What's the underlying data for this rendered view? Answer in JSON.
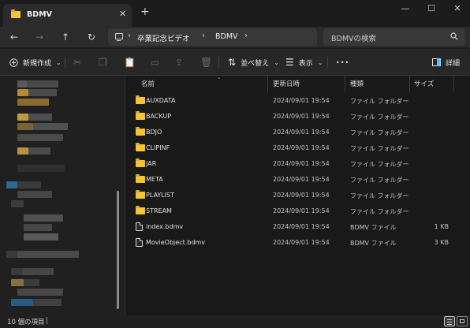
{
  "window": {
    "tab_title": "BDMV",
    "tab_close": "✕",
    "new_tab": "+",
    "minimize": "—",
    "maximize": "☐",
    "close": "✕"
  },
  "address": {
    "back": "←",
    "forward": "→",
    "up": "↑",
    "refresh": "↻",
    "crumbs": [
      "卒業記念ビデオ",
      "BDMV"
    ],
    "separator": "›",
    "search_placeholder": "BDMVの検索"
  },
  "toolbar": {
    "new_label": "新規作成",
    "sort_label": "並べ替え",
    "view_label": "表示",
    "more": "•••",
    "details_label": "詳細"
  },
  "columns": {
    "name": "名前",
    "modified": "更新日時",
    "type": "種類",
    "size": "サイズ"
  },
  "files": [
    {
      "name": "AUXDATA",
      "modified": "2024/09/01 19:54",
      "type": "ファイル フォルダー",
      "size": "",
      "kind": "folder"
    },
    {
      "name": "BACKUP",
      "modified": "2024/09/01 19:54",
      "type": "ファイル フォルダー",
      "size": "",
      "kind": "folder"
    },
    {
      "name": "BDJO",
      "modified": "2024/09/01 19:54",
      "type": "ファイル フォルダー",
      "size": "",
      "kind": "folder"
    },
    {
      "name": "CLIPINF",
      "modified": "2024/09/01 19:54",
      "type": "ファイル フォルダー",
      "size": "",
      "kind": "folder"
    },
    {
      "name": "JAR",
      "modified": "2024/09/01 19:54",
      "type": "ファイル フォルダー",
      "size": "",
      "kind": "folder"
    },
    {
      "name": "META",
      "modified": "2024/09/01 19:54",
      "type": "ファイル フォルダー",
      "size": "",
      "kind": "folder"
    },
    {
      "name": "PLAYLIST",
      "modified": "2024/09/01 19:54",
      "type": "ファイル フォルダー",
      "size": "",
      "kind": "folder"
    },
    {
      "name": "STREAM",
      "modified": "2024/09/01 19:54",
      "type": "ファイル フォルダー",
      "size": "",
      "kind": "folder"
    },
    {
      "name": "index.bdmv",
      "modified": "2024/09/01 19:54",
      "type": "BDMV ファイル",
      "size": "1 KB",
      "kind": "file"
    },
    {
      "name": "MovieObject.bdmv",
      "modified": "2024/09/01 19:54",
      "type": "BDMV ファイル",
      "size": "3 KB",
      "kind": "file"
    }
  ],
  "status": {
    "item_count": "10 個の項目",
    "separator": "|"
  },
  "colors": {
    "folder": "#f3c338",
    "background": "#191919",
    "accent": "#4cc2ff"
  }
}
